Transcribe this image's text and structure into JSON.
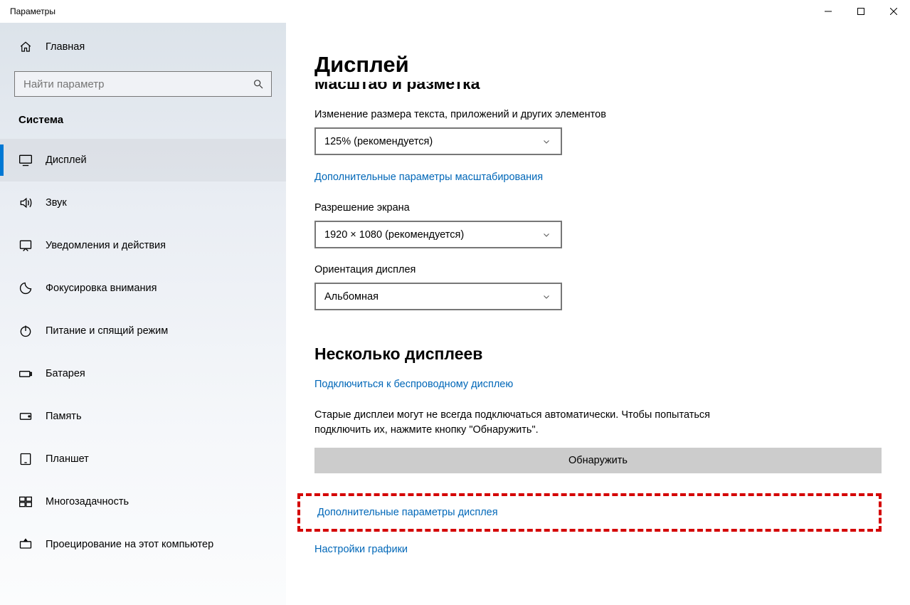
{
  "window": {
    "title": "Параметры"
  },
  "sidebar": {
    "home": "Главная",
    "search_placeholder": "Найти параметр",
    "category": "Система",
    "items": [
      {
        "label": "Дисплей"
      },
      {
        "label": "Звук"
      },
      {
        "label": "Уведомления и действия"
      },
      {
        "label": "Фокусировка внимания"
      },
      {
        "label": "Питание и спящий режим"
      },
      {
        "label": "Батарея"
      },
      {
        "label": "Память"
      },
      {
        "label": "Планшет"
      },
      {
        "label": "Многозадачность"
      },
      {
        "label": "Проецирование на этот компьютер"
      }
    ]
  },
  "main": {
    "page_title": "Дисплей",
    "clipped_section": "Масштаб и разметка",
    "scale": {
      "label": "Изменение размера текста, приложений и других элементов",
      "value": "125% (рекомендуется)"
    },
    "adv_scale_link": "Дополнительные параметры масштабирования",
    "resolution": {
      "label": "Разрешение экрана",
      "value": "1920 × 1080 (рекомендуется)"
    },
    "orientation": {
      "label": "Ориентация дисплея",
      "value": "Альбомная"
    },
    "multi": {
      "title": "Несколько дисплеев",
      "wireless_link": "Подключиться к беспроводному дисплею",
      "detect_text": "Старые дисплеи могут не всегда подключаться автоматически. Чтобы попытаться подключить их, нажмите кнопку \"Обнаружить\".",
      "detect_btn": "Обнаружить",
      "adv_display_link": "Дополнительные параметры дисплея",
      "graphics_link": "Настройки графики"
    }
  }
}
